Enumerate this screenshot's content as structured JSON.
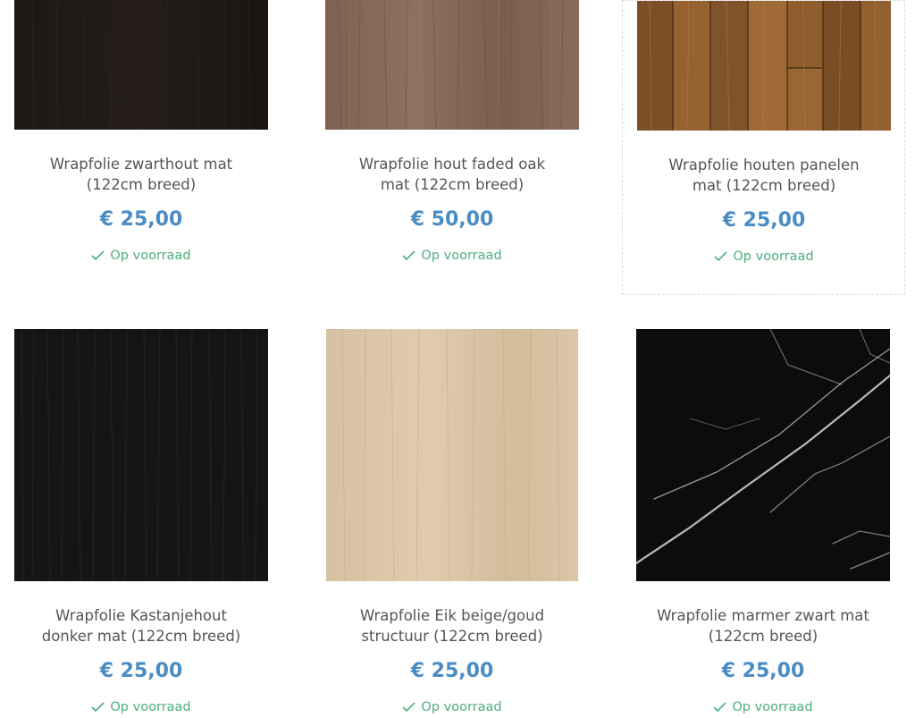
{
  "theme": {
    "price_color": "#4a8cc4",
    "stock_color": "#4caf7d",
    "title_color": "#555555"
  },
  "products": [
    {
      "title_line1": "Wrapfolie zwarthout mat",
      "title_line2": "(122cm breed)",
      "price": "€ 25,00",
      "stock": "Op voorraad",
      "swatch": "dark-wood"
    },
    {
      "title_line1": "Wrapfolie hout faded oak",
      "title_line2": "mat (122cm breed)",
      "price": "€ 50,00",
      "stock": "Op voorraad",
      "swatch": "faded-oak"
    },
    {
      "title_line1": "Wrapfolie houten panelen",
      "title_line2": "mat (122cm breed)",
      "price": "€ 25,00",
      "stock": "Op voorraad",
      "swatch": "wood-panels"
    },
    {
      "title_line1": "Wrapfolie Kastanjehout",
      "title_line2": "donker mat (122cm breed)",
      "price": "€ 25,00",
      "stock": "Op voorraad",
      "swatch": "black-wood"
    },
    {
      "title_line1": "Wrapfolie Eik beige/goud",
      "title_line2": "structuur (122cm breed)",
      "price": "€ 25,00",
      "stock": "Op voorraad",
      "swatch": "beige-oak"
    },
    {
      "title_line1": "Wrapfolie marmer zwart mat",
      "title_line2": "(122cm breed)",
      "price": "€ 25,00",
      "stock": "Op voorraad",
      "swatch": "black-marble"
    }
  ]
}
